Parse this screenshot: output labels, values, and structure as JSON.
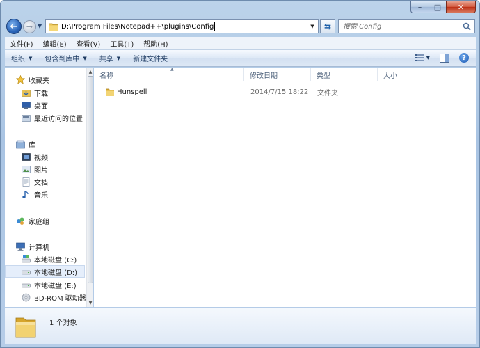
{
  "window": {
    "caption_min_glyph": "–",
    "caption_max_glyph": "□",
    "caption_close_glyph": "✕"
  },
  "nav": {
    "back_glyph": "←",
    "forward_glyph": "→",
    "address": "D:\\Program Files\\Notepad++\\plugins\\Config",
    "search_placeholder": "搜索 Config"
  },
  "menu": [
    {
      "label": "文件(F)"
    },
    {
      "label": "编辑(E)"
    },
    {
      "label": "查看(V)"
    },
    {
      "label": "工具(T)"
    },
    {
      "label": "帮助(H)"
    }
  ],
  "toolbar": {
    "organize": "组织",
    "include_library": "包含到库中",
    "share": "共享",
    "new_folder": "新建文件夹",
    "help_glyph": "?"
  },
  "sidebar": {
    "favorites": "收藏夹",
    "downloads": "下载",
    "desktop": "桌面",
    "recent": "最近访问的位置",
    "libraries": "库",
    "videos": "视频",
    "pictures": "图片",
    "documents": "文档",
    "music": "音乐",
    "homegroup": "家庭组",
    "computer": "计算机",
    "disk_c": "本地磁盘 (C:)",
    "disk_d": "本地磁盘 (D:)",
    "disk_e": "本地磁盘 (E:)",
    "bd_rom": "BD-ROM 驱动器"
  },
  "columns": {
    "name": "名称",
    "modified": "修改日期",
    "type": "类型",
    "size": "大小"
  },
  "files": [
    {
      "name": "Hunspell",
      "modified": "2014/7/15 18:22",
      "type": "文件夹",
      "size": ""
    }
  ],
  "status": {
    "count": "1 个对象"
  },
  "colors": {
    "frame": "#a9c4e3",
    "accent": "#1e5bb3",
    "selected": "#e5eefb",
    "folder": "#e8c254"
  }
}
